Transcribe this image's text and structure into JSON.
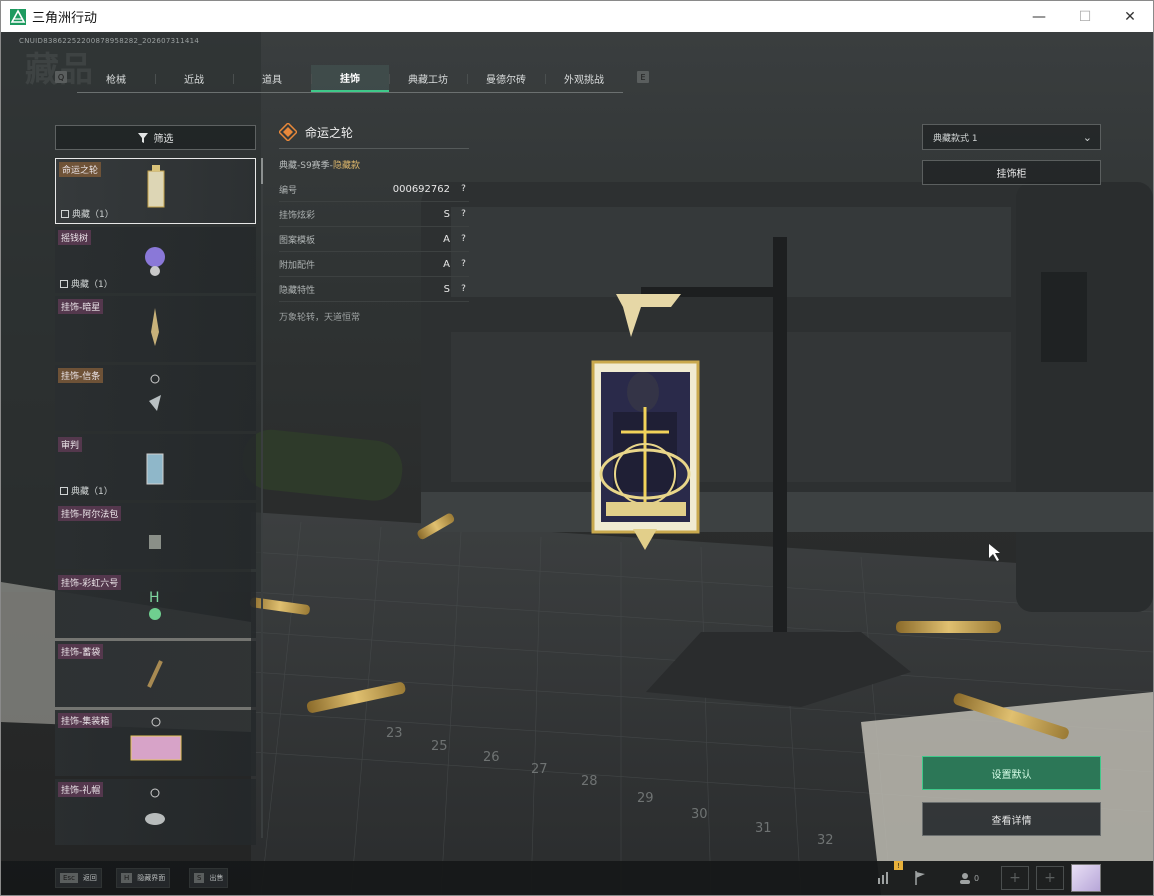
{
  "window": {
    "title": "三角洲行动",
    "minimize_glyph": "—",
    "maximize_glyph": "☐",
    "close_glyph": "✕",
    "app_icon": "delta-triangle-icon",
    "accent_color": "#3fc98a"
  },
  "header": {
    "uid": "CNUID83862252200878958282_202607311414",
    "page_title": "藏品"
  },
  "tabs": {
    "prev_key": "Q",
    "next_key": "E",
    "items": [
      {
        "label": "枪械"
      },
      {
        "label": "近战"
      },
      {
        "label": "道具"
      },
      {
        "label": "挂饰",
        "active": true
      },
      {
        "label": "典藏工坊"
      },
      {
        "label": "曼德尔砖"
      },
      {
        "label": "外观挑战"
      }
    ]
  },
  "filter": {
    "label": "筛选",
    "icon": "filter-icon"
  },
  "list": {
    "items": [
      {
        "tag": "命运之轮",
        "sub": "典藏（1）",
        "rarity": "gold",
        "selected": true
      },
      {
        "tag": "摇钱树",
        "sub": "典藏（1）",
        "rarity": "purple"
      },
      {
        "tag": "挂饰-暗星",
        "sub": "",
        "rarity": "purple"
      },
      {
        "tag": "挂饰-信条",
        "sub": "",
        "rarity": "gold"
      },
      {
        "tag": "审判",
        "sub": "典藏（1）",
        "rarity": "purple"
      },
      {
        "tag": "挂饰-阿尔法包",
        "sub": "",
        "rarity": "purple"
      },
      {
        "tag": "挂饰-彩虹六号",
        "sub": "",
        "rarity": "purple"
      },
      {
        "tag": "挂饰-蓄袋",
        "sub": "",
        "rarity": "purple"
      },
      {
        "tag": "挂饰-集装箱",
        "sub": "",
        "rarity": "purple"
      },
      {
        "tag": "挂饰-礼帽",
        "sub": "",
        "rarity": "purple"
      }
    ]
  },
  "detail": {
    "name": "命运之轮",
    "season_prefix": "典藏-S9赛季-",
    "season_hidden": "隐藏款",
    "rows": [
      {
        "label": "编号",
        "value": "000692762",
        "help": "?"
      },
      {
        "label": "挂饰炫彩",
        "value": "S",
        "help": "?"
      },
      {
        "label": "图案模板",
        "value": "A",
        "help": "?"
      },
      {
        "label": "附加配件",
        "value": "A",
        "help": "?"
      },
      {
        "label": "隐藏特性",
        "value": "S",
        "help": "?"
      }
    ],
    "description": "万象轮转，天道恒常"
  },
  "right": {
    "style_select": "典藏款式 1",
    "cabinet_button": "挂饰柜",
    "default_button": "设置默认",
    "view_detail_button": "查看详情"
  },
  "bottom": {
    "hints": [
      {
        "key": "Esc",
        "label": "返回"
      },
      {
        "key": "H",
        "label": "隐藏界面"
      },
      {
        "key": "S",
        "label": "出售"
      }
    ],
    "badge": "!",
    "friends_count": "0",
    "slot_glyph": "+"
  }
}
